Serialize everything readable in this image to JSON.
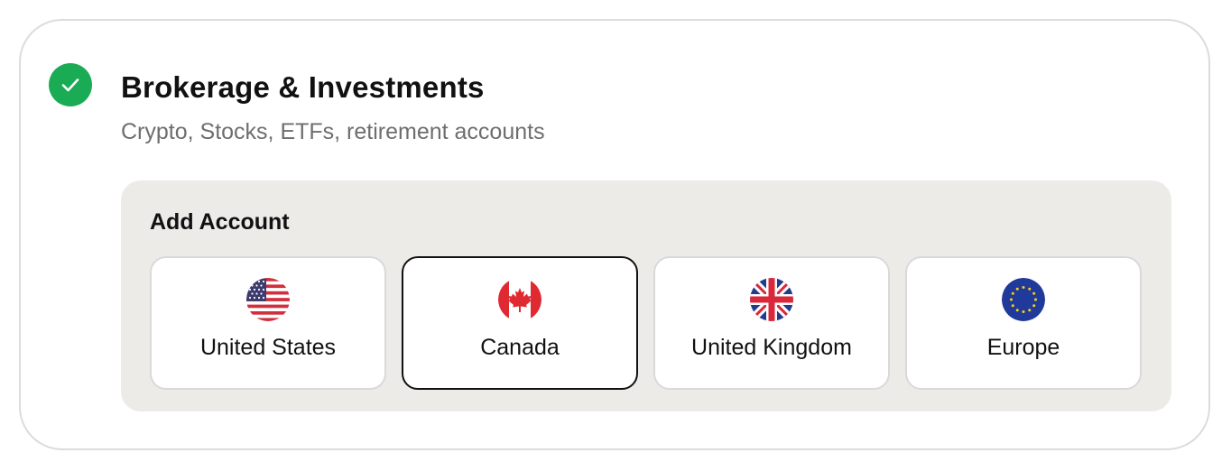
{
  "section": {
    "title": "Brokerage & Investments",
    "subtitle": "Crypto, Stocks, ETFs, retirement accounts",
    "status_icon": "check-circle-icon",
    "status_color": "#1aab55"
  },
  "add_account": {
    "title": "Add Account",
    "regions": [
      {
        "label": "United States",
        "icon": "us-flag-icon",
        "selected": false
      },
      {
        "label": "Canada",
        "icon": "canada-flag-icon",
        "selected": true
      },
      {
        "label": "United Kingdom",
        "icon": "uk-flag-icon",
        "selected": false
      },
      {
        "label": "Europe",
        "icon": "eu-flag-icon",
        "selected": false
      }
    ]
  }
}
